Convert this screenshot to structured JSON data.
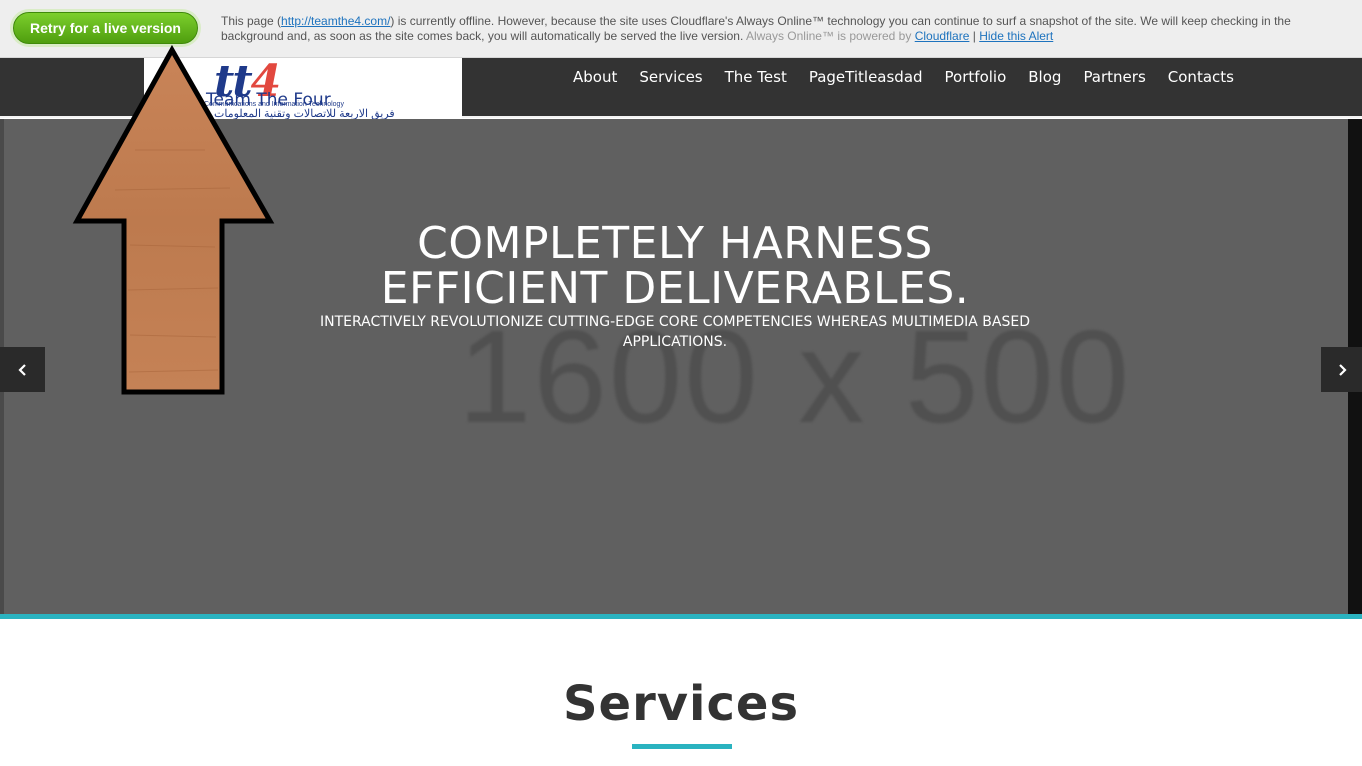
{
  "cloudflare_bar": {
    "retry_label": "Retry for a live version",
    "msg_prefix": "This page (",
    "site_link": "http://teamthe4.com/",
    "msg_body": ") is currently offline. However, because the site uses Cloudflare's Always Online™ technology you can continue to surf a snapshot of the site. We will keep checking in the background and, as soon as the site comes back, you will automatically be served the live version.",
    "powered_text": "Always Online™ is powered by",
    "cloudflare_link": "Cloudflare",
    "separator": "|",
    "hide_link": "Hide this Alert"
  },
  "logo": {
    "mark_tt": "tt",
    "mark_4": "4",
    "name": "Team The Four",
    "sub": "Communications and Information Technology",
    "arabic": "فريق الاربعة للاتصالات وتقنية المعلومات"
  },
  "nav": {
    "items": [
      "About",
      "Services",
      "The Test",
      "PageTitleasdad",
      "Portfolio",
      "Blog",
      "Partners",
      "Contacts"
    ]
  },
  "hero": {
    "placeholder": "1600 x 500",
    "title_line1": "COMPLETELY HARNESS",
    "title_line2": "EFFICIENT DELIVERABLES.",
    "subtitle": "INTERACTIVELY REVOLUTIONIZE CUTTING-EDGE CORE COMPETENCIES WHEREAS MULTIMEDIA BASED APPLICATIONS.",
    "prev_icon": "chevron-left-icon",
    "next_icon": "chevron-right-icon"
  },
  "services": {
    "title": "Services"
  },
  "annotation": {
    "icon": "up-arrow-icon"
  },
  "colors": {
    "accent": "#2ab3c0",
    "nav_bg": "#333333",
    "hero_bg": "#606060",
    "retry_green": "#5cb21a",
    "arrow_fill": "#c27a52"
  }
}
